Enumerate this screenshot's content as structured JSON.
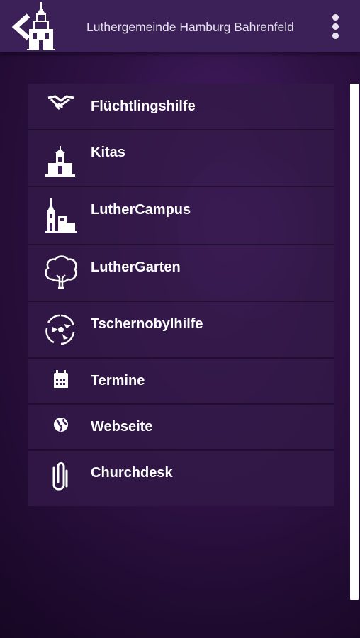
{
  "header": {
    "title": "Luthergemeinde Hamburg Bahrenfeld",
    "back_icon": "back-chevron-icon",
    "logo_icon": "church-tower-logo",
    "menu_icon": "overflow-menu-icon"
  },
  "menu": {
    "items": [
      {
        "label": "Flüchtlingshilfe",
        "icon": "handshake-icon"
      },
      {
        "label": "Kitas",
        "icon": "kita-building-icon"
      },
      {
        "label": "LutherCampus",
        "icon": "campus-buildings-icon"
      },
      {
        "label": "LutherGarten",
        "icon": "tree-icon"
      },
      {
        "label": "Tschernobylhilfe",
        "icon": "tschernobyl-logo-icon"
      },
      {
        "label": "Termine",
        "icon": "calendar-icon"
      },
      {
        "label": "Webseite",
        "icon": "globe-icon"
      },
      {
        "label": "Churchdesk",
        "icon": "paperclip-icon"
      }
    ]
  },
  "colors": {
    "topbar": "#3b2157",
    "background": "#2f1245",
    "text": "#ffffff"
  }
}
